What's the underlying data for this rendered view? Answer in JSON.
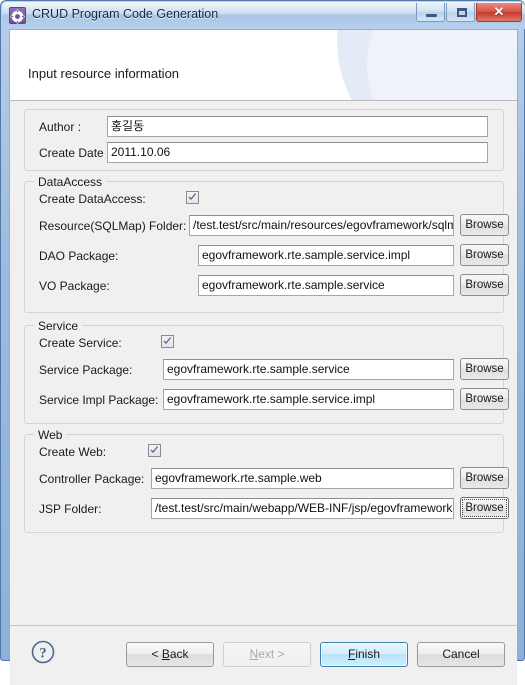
{
  "window": {
    "title": "CRUD Program Code Generation",
    "icon": "gear-icon",
    "minimize_label": "",
    "maximize_label": "",
    "close_label": "✕"
  },
  "banner": {
    "title": "Input resource information"
  },
  "author_group": {
    "author_label": "Author :",
    "author_value": "홍길동",
    "create_date_label": "Create Date :",
    "create_date_value": "2011.10.06"
  },
  "dataaccess_group": {
    "legend": "DataAccess",
    "create_label": "Create DataAccess:",
    "create_checked": true,
    "rows": [
      {
        "label": "Resource(SQLMap) Folder:",
        "value": "/test.test/src/main/resources/egovframework/sqlmap",
        "browse": "Browse"
      },
      {
        "label": "DAO Package:",
        "value": "egovframework.rte.sample.service.impl",
        "browse": "Browse"
      },
      {
        "label": "VO Package:",
        "value": "egovframework.rte.sample.service",
        "browse": "Browse"
      }
    ]
  },
  "service_group": {
    "legend": "Service",
    "create_label": "Create Service:",
    "create_checked": true,
    "rows": [
      {
        "label": "Service Package:",
        "value": "egovframework.rte.sample.service",
        "browse": "Browse"
      },
      {
        "label": "Service Impl Package:",
        "value": "egovframework.rte.sample.service.impl",
        "browse": "Browse"
      }
    ]
  },
  "web_group": {
    "legend": "Web",
    "create_label": "Create Web:",
    "create_checked": true,
    "rows": [
      {
        "label": "Controller Package:",
        "value": "egovframework.rte.sample.web",
        "browse": "Browse"
      },
      {
        "label": "JSP Folder:",
        "value": "/test.test/src/main/webapp/WEB-INF/jsp/egovframework",
        "browse": "Browse"
      }
    ]
  },
  "footer": {
    "help_icon": "question-mark-icon",
    "back_label": "< Back",
    "next_label": "Next >",
    "finish_label": "Finish",
    "cancel_label": "Cancel"
  },
  "colors": {
    "accent": "#3c7fb1",
    "titlebar": "#bed5ee",
    "panel": "#f0f0f0",
    "close_button": "#d9564a"
  }
}
